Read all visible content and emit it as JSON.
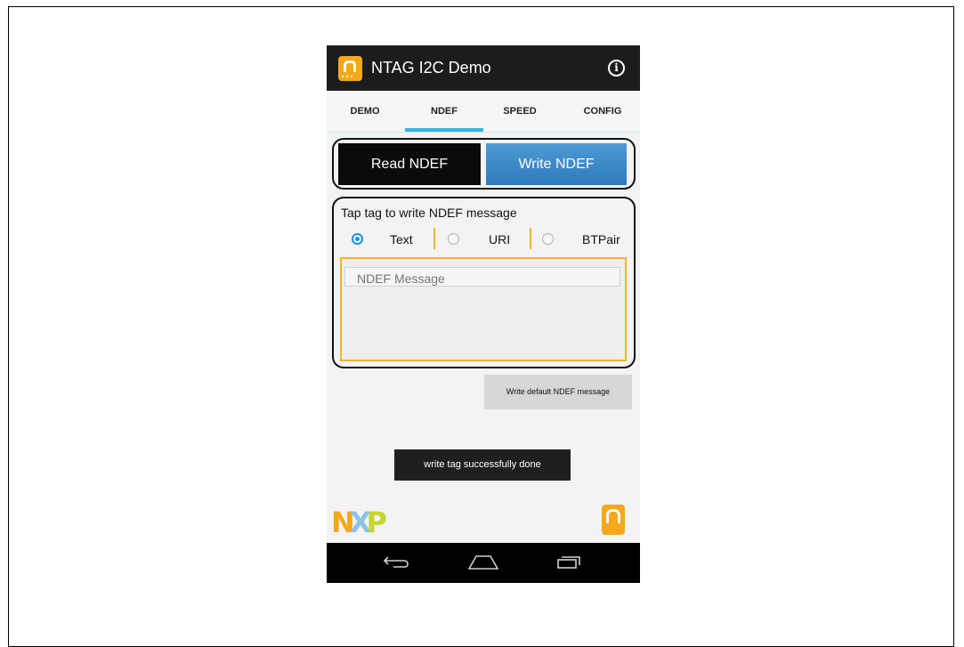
{
  "app": {
    "title": "NTAG I2C Demo"
  },
  "tabs": [
    {
      "label": "DEMO"
    },
    {
      "label": "NDEF"
    },
    {
      "label": "SPEED"
    },
    {
      "label": "CONFIG"
    }
  ],
  "active_tab": "NDEF",
  "mode_buttons": {
    "read_label": "Read NDEF",
    "write_label": "Write NDEF",
    "selected": "Write NDEF"
  },
  "write_panel": {
    "title": "Tap tag to write NDEF message",
    "types": [
      {
        "label": "Text",
        "checked": true
      },
      {
        "label": "URI",
        "checked": false
      },
      {
        "label": "BTPair",
        "checked": false
      }
    ],
    "message_placeholder": "NDEF Message",
    "message_value": ""
  },
  "default_button_label": "Write default NDEF message",
  "toast_text": "write tag successfully done",
  "branding": {
    "logo_letters": [
      "N",
      "X",
      "P"
    ]
  },
  "colors": {
    "accent_blue": "#33b5e5",
    "write_button": "#2e7bbd",
    "brand_orange": "#f5a81c",
    "action_bar": "#1c1c1c"
  },
  "icons": {
    "app": "app-logo-icon",
    "info": "info-icon",
    "nav_back": "back-icon",
    "nav_home": "home-icon",
    "nav_recent": "recent-apps-icon"
  }
}
